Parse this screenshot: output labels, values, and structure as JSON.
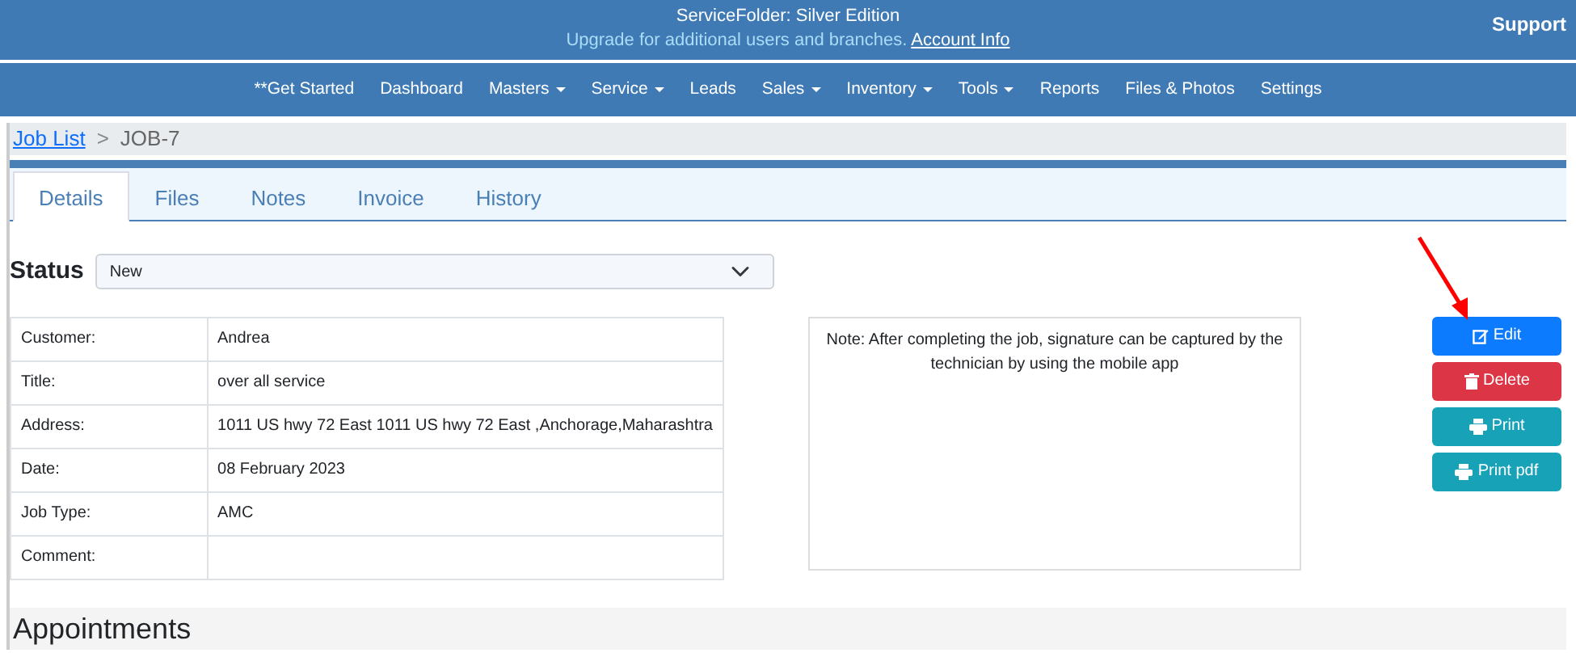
{
  "header": {
    "title": "ServiceFolder: Silver Edition",
    "upgrade_text": "Upgrade for additional users and branches.",
    "account_link": "Account Info",
    "support": "Support"
  },
  "nav": [
    {
      "label": "**Get Started",
      "dropdown": false
    },
    {
      "label": "Dashboard",
      "dropdown": false
    },
    {
      "label": "Masters",
      "dropdown": true
    },
    {
      "label": "Service",
      "dropdown": true
    },
    {
      "label": "Leads",
      "dropdown": false
    },
    {
      "label": "Sales",
      "dropdown": true
    },
    {
      "label": "Inventory",
      "dropdown": true
    },
    {
      "label": "Tools",
      "dropdown": true
    },
    {
      "label": "Reports",
      "dropdown": false
    },
    {
      "label": "Files & Photos",
      "dropdown": false
    },
    {
      "label": "Settings",
      "dropdown": false
    }
  ],
  "breadcrumb": {
    "link": "Job List",
    "separator": ">",
    "current": "JOB-7"
  },
  "tabs": [
    {
      "label": "Details",
      "selected": true
    },
    {
      "label": "Files",
      "selected": false
    },
    {
      "label": "Notes",
      "selected": false
    },
    {
      "label": "Invoice",
      "selected": false
    },
    {
      "label": "History",
      "selected": false
    }
  ],
  "status": {
    "label": "Status",
    "value": "New"
  },
  "details": [
    {
      "label": "Customer:",
      "value": "Andrea"
    },
    {
      "label": "Title:",
      "value": "over all service"
    },
    {
      "label": "Address:",
      "value": "1011 US hwy 72 East 1011 US hwy 72 East ,Anchorage,Maharashtra"
    },
    {
      "label": "Date:",
      "value": "08 February 2023"
    },
    {
      "label": "Job Type:",
      "value": "AMC"
    },
    {
      "label": "Comment:"
    }
  ],
  "note": "Note: After completing the job, signature can be captured by the technician by using the mobile app",
  "buttons": [
    {
      "label": "Edit",
      "kind": "edit"
    },
    {
      "label": "Delete",
      "kind": "delete"
    },
    {
      "label": "Print",
      "kind": "print"
    },
    {
      "label": "Print pdf",
      "kind": "print"
    }
  ],
  "section_title": "Appointments"
}
